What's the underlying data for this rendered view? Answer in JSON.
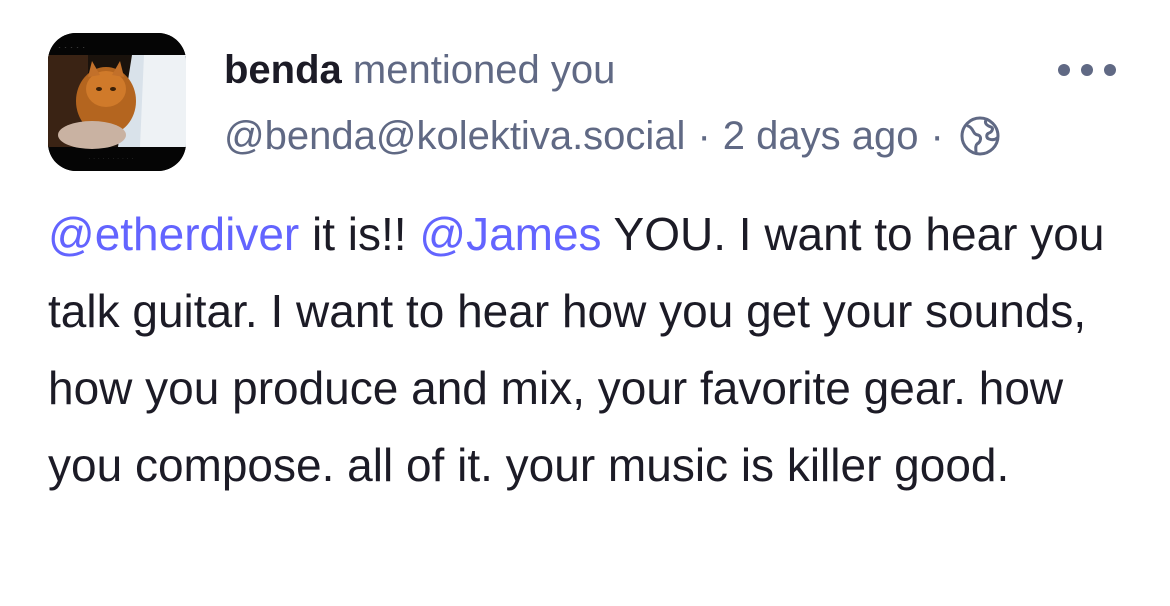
{
  "notification": {
    "actor": {
      "display_name": "benda",
      "handle": "@benda@kolektiva.social",
      "avatar": "cat-photo-avatar"
    },
    "action": "mentioned you",
    "time": "2 days ago",
    "separator": "·",
    "visibility_icon": "globe-icon",
    "more_icon": "ellipsis-icon"
  },
  "post": {
    "mention_1": "@etherdiver",
    "text_1": " it is!! ",
    "mention_2": "@James",
    "text_2": " YOU. I want to hear you talk guitar. I want to hear how you get your sounds, how you produce and mix, your favorite gear. how you compose. all of it. your music is killer good."
  },
  "colors": {
    "text": "#1c1b26",
    "secondary": "#606984",
    "mention": "#6364ff"
  }
}
